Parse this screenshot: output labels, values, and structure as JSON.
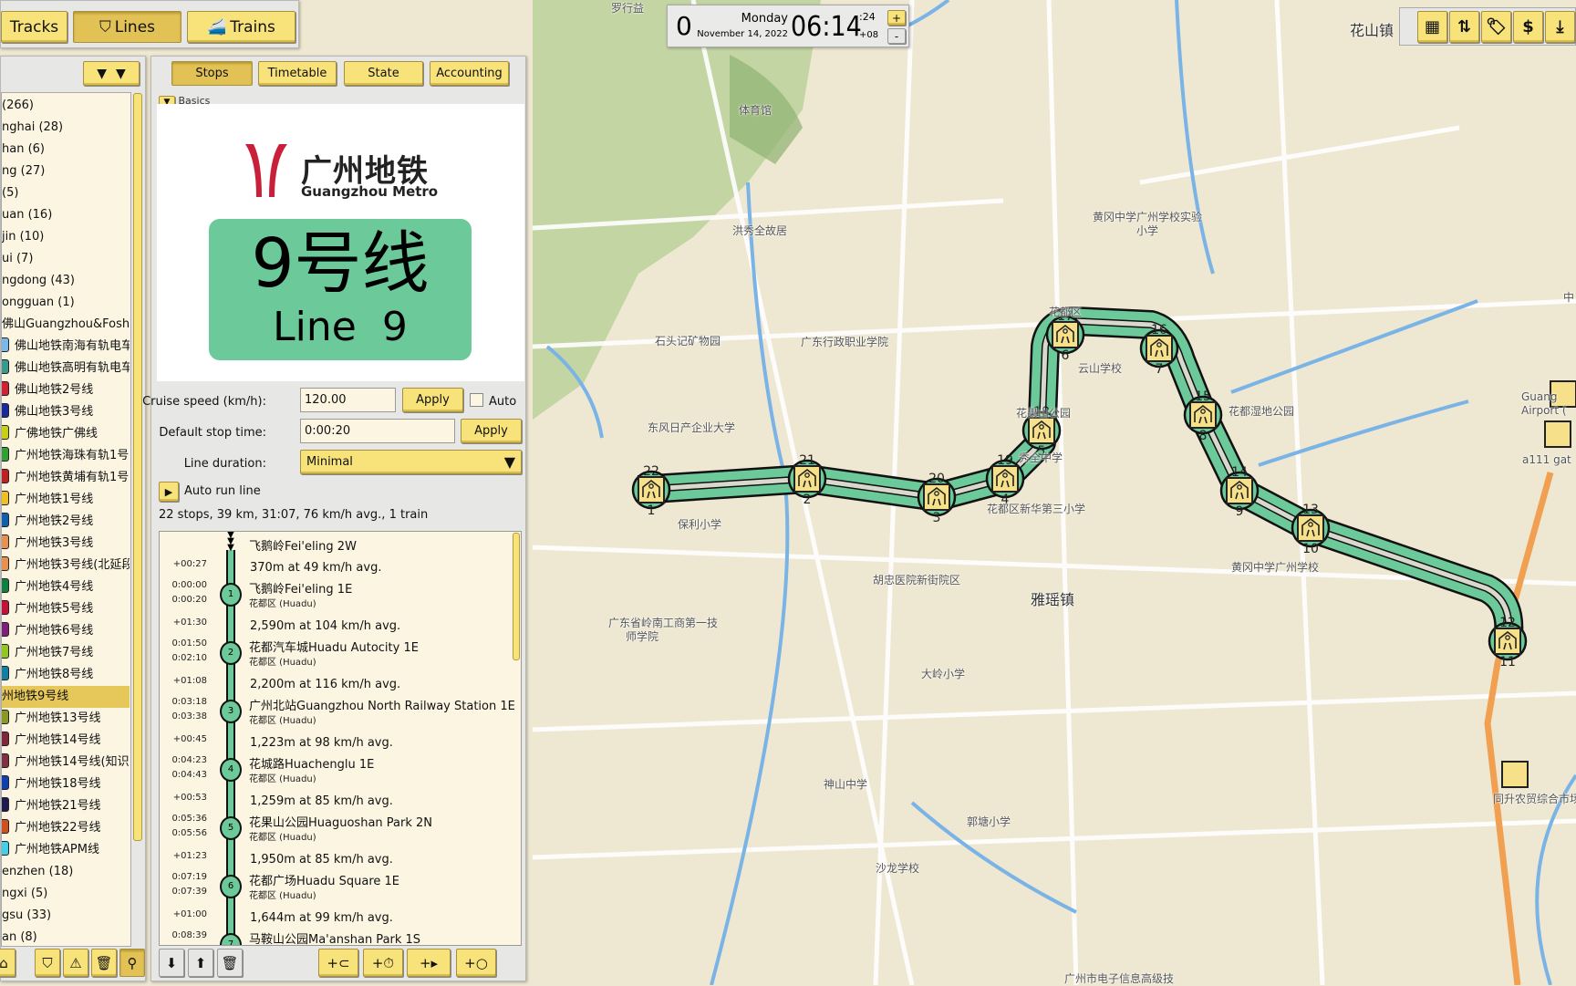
{
  "colors": {
    "accent": "#f8e27a",
    "selected": "#e2c254",
    "line9": "#6cc99a",
    "logo_red": "#c8203a",
    "rail": "#f0a050"
  },
  "top_nav": {
    "tracks": "Tracks",
    "lines": "Lines",
    "trains": "Trains",
    "tracks_icon": "track-icon",
    "lines_icon": "lines-icon",
    "trains_icon": "train-icon"
  },
  "line_list": {
    "filter_icon": "filter-icon",
    "dropdown_icon": "chevron-down-icon",
    "items": [
      {
        "label": "(266)"
      },
      {
        "label": "nghai (28)"
      },
      {
        "label": "han (6)"
      },
      {
        "label": "ng (27)"
      },
      {
        "label": "(5)"
      },
      {
        "label": "uan (16)"
      },
      {
        "label": "jin (10)"
      },
      {
        "label": "ui (7)"
      },
      {
        "label": "ngdong (43)"
      },
      {
        "label": "ongguan (1)"
      },
      {
        "label": "佛山Guangzhou&Foshan"
      },
      {
        "label": "佛山地铁南海有轨电车1号",
        "color": "#7ab8e8"
      },
      {
        "label": "佛山地铁高明有轨电车",
        "color": "#3a9a8a"
      },
      {
        "label": "佛山地铁2号线",
        "color": "#d42030"
      },
      {
        "label": "佛山地铁3号线",
        "color": "#1a2a9a"
      },
      {
        "label": "广佛地铁广佛线",
        "color": "#c8d010"
      },
      {
        "label": "广州地铁海珠有轨1号线",
        "color": "#30a030"
      },
      {
        "label": "广州地铁黄埔有轨1号线",
        "color": "#c02020"
      },
      {
        "label": "广州地铁1号线",
        "color": "#f0c020"
      },
      {
        "label": "广州地铁2号线",
        "color": "#1060b0"
      },
      {
        "label": "广州地铁3号线",
        "color": "#e89050"
      },
      {
        "label": "广州地铁3号线(北延段)",
        "color": "#e89050"
      },
      {
        "label": "广州地铁4号线",
        "color": "#108040"
      },
      {
        "label": "广州地铁5号线",
        "color": "#c8103a"
      },
      {
        "label": "广州地铁6号线",
        "color": "#80207a"
      },
      {
        "label": "广州地铁7号线",
        "color": "#90c820"
      },
      {
        "label": "广州地铁8号线",
        "color": "#1080a0"
      },
      {
        "label": "州地铁9号线",
        "selected": true
      },
      {
        "label": "广州地铁13号线",
        "color": "#8a9a20"
      },
      {
        "label": "广州地铁14号线",
        "color": "#802838"
      },
      {
        "label": "广州地铁14号线(知识城",
        "color": "#803040"
      },
      {
        "label": "广州地铁18号线",
        "color": "#1040b0"
      },
      {
        "label": "广州地铁21号线",
        "color": "#201a50"
      },
      {
        "label": "广州地铁22号线",
        "color": "#d05020"
      },
      {
        "label": "广州地铁APM线",
        "color": "#40d0e8"
      },
      {
        "label": "enzhen (18)"
      },
      {
        "label": "ngxi (5)"
      },
      {
        "label": "gsu (33)"
      },
      {
        "label": "an (8)"
      }
    ],
    "toolbar": [
      "house-icon",
      "lines-icon",
      "warning-icon",
      "trash-icon",
      "location-pin-icon"
    ]
  },
  "tabs": {
    "stops": "Stops",
    "timetable": "Timetable",
    "state": "State",
    "accounting": "Accounting"
  },
  "basics": {
    "header": "Basics",
    "logo_cn": "广州地铁",
    "logo_en": "Guangzhou Metro",
    "sign_cn": "9号线",
    "sign_en": "Line  9"
  },
  "settings": {
    "cruise_label": "Cruise speed (km/h):",
    "cruise_value": "120.00",
    "apply": "Apply",
    "auto": "Auto",
    "auto_checked": false,
    "stop_label": "Default stop time:",
    "stop_value": "0:00:20",
    "duration_label": "Line duration:",
    "duration_value": "Minimal",
    "autorun": "Auto run line",
    "summary": "22 stops, 39 km, 31:07, 76 km/h avg., 1 train"
  },
  "stop_list": {
    "first": "飞鹅岭Fei'eling 2W",
    "items": [
      {
        "seg_time": "+00:27",
        "seg": "370m at 49 km/h avg.",
        "num": "1",
        "arr": "0:00:00",
        "dep": "0:00:20",
        "name": "飞鹅岭Fei'eling 1E",
        "area": "花都区 (Huadu)"
      },
      {
        "seg_time": "+01:30",
        "seg": "2,590m at 104 km/h avg.",
        "num": "2",
        "arr": "0:01:50",
        "dep": "0:02:10",
        "name": "花都汽车城Huadu Autocity 1E",
        "area": "花都区 (Huadu)"
      },
      {
        "seg_time": "+01:08",
        "seg": "2,200m at 116 km/h avg.",
        "num": "3",
        "arr": "0:03:18",
        "dep": "0:03:38",
        "name": "广州北站Guangzhou North Railway Station 1E",
        "area": "花都区 (Huadu)"
      },
      {
        "seg_time": "+00:45",
        "seg": "1,223m at 98 km/h avg.",
        "num": "4",
        "arr": "0:04:23",
        "dep": "0:04:43",
        "name": "花城路Huachenglu 1E",
        "area": "花都区 (Huadu)"
      },
      {
        "seg_time": "+00:53",
        "seg": "1,259m at 85 km/h avg.",
        "num": "5",
        "arr": "0:05:36",
        "dep": "0:05:56",
        "name": "花果山公园Huaguoshan Park 2N",
        "area": "花都区 (Huadu)"
      },
      {
        "seg_time": "+01:23",
        "seg": "1,950m at 85 km/h avg.",
        "num": "6",
        "arr": "0:07:19",
        "dep": "0:07:39",
        "name": "花都广场Huadu Square 1E",
        "area": "花都区 (Huadu)"
      },
      {
        "seg_time": "+01:00",
        "seg": "1,644m at 99 km/h avg.",
        "num": "7",
        "arr": "0:08:39",
        "dep": "",
        "name": "马鞍山公园Ma'anshan Park 1S",
        "area": ""
      }
    ],
    "toolbar": [
      "arrow-down-icon",
      "arrow-up-icon",
      "trash-icon",
      "add-train-icon",
      "add-schedule-icon",
      "add-play-icon",
      "add-circle-icon"
    ]
  },
  "clock": {
    "speed": "0",
    "weekday": "Monday",
    "date": "November 14, 2022",
    "time": "06:14",
    "seconds": ":24",
    "tz": "+08",
    "plus": "+",
    "minus": "-"
  },
  "right_toolbar": [
    "map-icon",
    "sort-icon",
    "tag-icon",
    "dollar-icon",
    "download-icon"
  ],
  "map": {
    "stations": [
      {
        "a": "1",
        "b": "22"
      },
      {
        "a": "2",
        "b": "21"
      },
      {
        "a": "3",
        "b": "20"
      },
      {
        "a": "4",
        "b": "19"
      },
      {
        "a": "5",
        "b": "18"
      },
      {
        "a": "6",
        "b": "17"
      },
      {
        "a": "7",
        "b": "16"
      },
      {
        "a": "8",
        "b": "15"
      },
      {
        "a": "9",
        "b": "14"
      },
      {
        "a": "10",
        "b": "13"
      },
      {
        "a": "11",
        "b": "12"
      }
    ],
    "labels": [
      "罗行益",
      "体育馆",
      "洪秀全故居",
      "黄冈中学广州学校实验",
      "小学",
      "花都区",
      "石头记矿物园",
      "广东行政职业学院",
      "云山学校",
      "花果山公园",
      "花都湿地公园",
      "东风日产企业大学",
      "秀全中学",
      "保利小学",
      "花都区新华第三小学",
      "黄冈中学广州学校",
      "胡忠医院新街院区",
      "雅瑶镇",
      "广东省岭南工商第一技",
      "师学院",
      "大岭小学",
      "神山中学",
      "郭塘小学",
      "沙龙学校",
      "同升农贸综合市场",
      "广州市电子信息高级技",
      "花山镇",
      "Guang",
      "Airport (",
      "a111 gat",
      "中"
    ]
  }
}
